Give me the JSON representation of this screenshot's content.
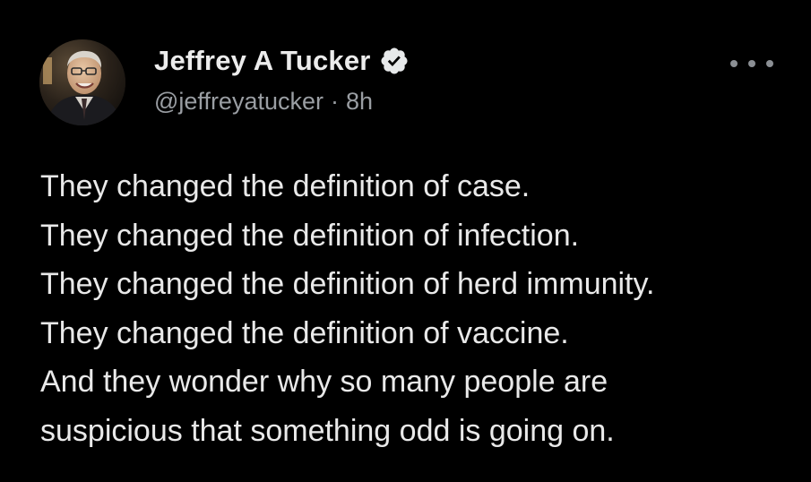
{
  "author": {
    "display_name": "Jeffrey A Tucker",
    "handle": "@jeffreyatucker",
    "separator": "·",
    "timestamp": "8h",
    "verified": true,
    "verified_icon": "verified-badge-icon",
    "avatar_icon": "profile-avatar"
  },
  "menu": {
    "icon": "more-options-icon"
  },
  "tweet": {
    "lines": [
      "They changed the definition of case.",
      "They changed the definition of infection.",
      "They changed the definition of herd immunity.",
      "They changed the definition of vaccine.",
      "And they wonder why so many people are",
      "suspicious that something odd is going on."
    ]
  },
  "colors": {
    "background": "#000000",
    "text": "#e7e9ea",
    "secondary_text": "#9a9ea3",
    "verified_badge": "#e7e9ea"
  }
}
